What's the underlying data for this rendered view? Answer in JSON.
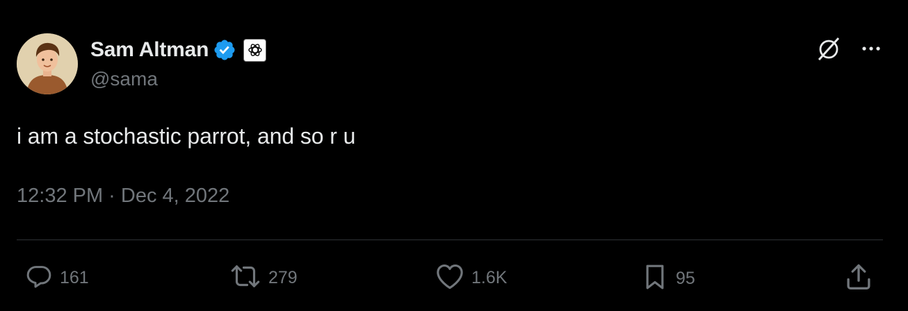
{
  "author": {
    "display_name": "Sam Altman",
    "handle": "@sama",
    "verified": true,
    "affiliation_icon": "openai-logo-icon",
    "verified_color": "#1d9bf0"
  },
  "tweet": {
    "text": "i am a stochastic parrot, and so r u",
    "timestamp": "12:32 PM · Dec 4, 2022"
  },
  "top_icons": [
    "grok-icon",
    "more-icon"
  ],
  "actions": {
    "replies": {
      "icon": "reply-icon",
      "count": "161"
    },
    "retweets": {
      "icon": "retweet-icon",
      "count": "279"
    },
    "likes": {
      "icon": "heart-icon",
      "count": "1.6K"
    },
    "bookmarks": {
      "icon": "bookmark-icon",
      "count": "95"
    },
    "share": {
      "icon": "share-icon"
    }
  },
  "colors": {
    "background": "#000000",
    "primary_text": "#e7e9ea",
    "secondary_text": "#71767b",
    "divider": "#2f3336"
  }
}
